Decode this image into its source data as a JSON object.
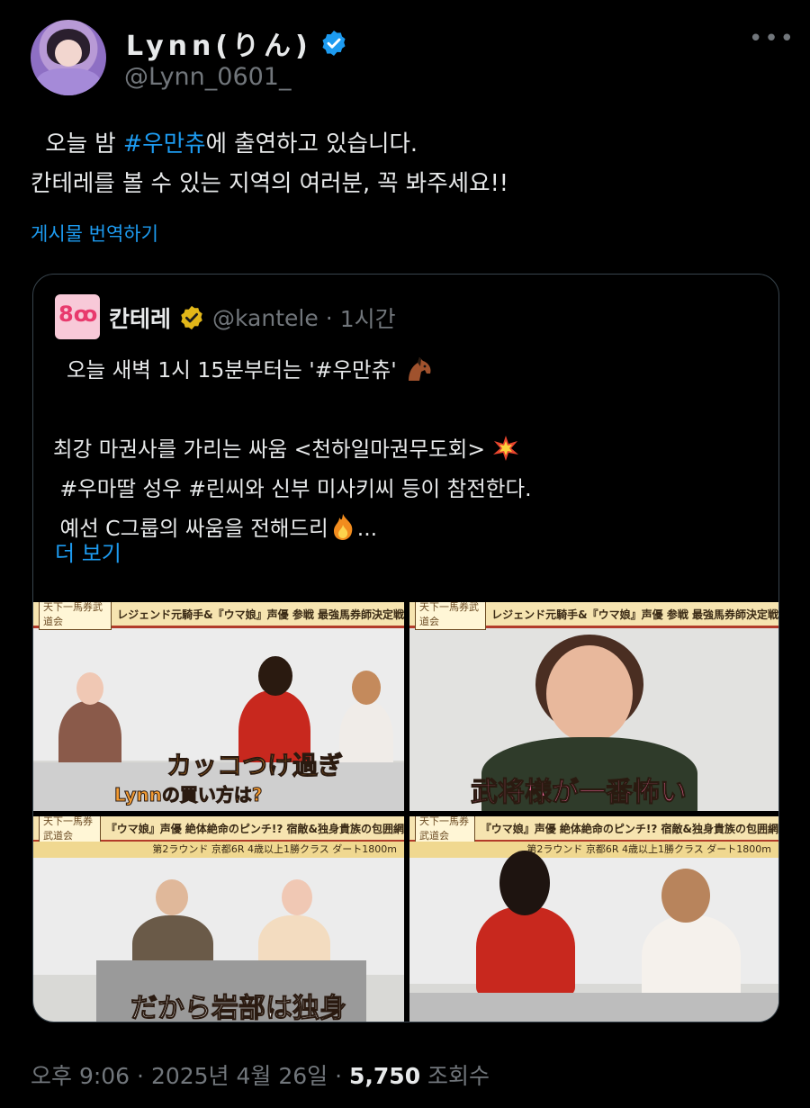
{
  "author": {
    "display_name": "Lynn(りん)",
    "handle": "@Lynn_0601_",
    "verified_color": "#1d9bf0"
  },
  "icons": [
    "verified-icon",
    "more-icon",
    "gold-verified-icon",
    "horse-emoji",
    "collision-emoji",
    "fire-emoji"
  ],
  "tweet": {
    "line1_pre": "  오늘 밤 ",
    "line1_tag": "#우만츄",
    "line1_post": "에 출연하고 있습니다.",
    "line2": "칸테레를 볼 수 있는 지역의 여러분, 꼭 봐주세요!!",
    "translate_label": "게시물 번역하기"
  },
  "quote": {
    "avatar_text": "8ꚙ",
    "name": "칸테레",
    "handle": "@kantele",
    "separator": " · ",
    "time": "1시간",
    "line1": "  오늘 새벽 1시 15분부터는 '#우만츄'",
    "line3": "최강 마권사를 가리는 싸움 <천하일마권무도회>",
    "line4": " #우마딸 성우 #린씨와 신부 미사키씨 등이 참전한다.",
    "line5": " 예선 C그룹의 싸움을 전해드리",
    "line5_end": "...",
    "more_label": "더 보기",
    "gold_badge_color": "#e2b719"
  },
  "media": [
    {
      "tag": "天下一馬券武道会",
      "banner": "レジェンド元騎手&『ウマ娘』声優 参戦 最強馬券師決定戦",
      "sub": "",
      "caption": "カッコつけ過ぎ",
      "caption2": "Lynnの買い方は?"
    },
    {
      "tag": "天下一馬券武道会",
      "banner": "レジェンド元騎手&『ウマ娘』声優 参戦 最強馬券師決定戦",
      "sub": "",
      "caption": "武将様が一番怖い",
      "caption2": ""
    },
    {
      "tag": "天下一馬券武道会",
      "banner": "『ウマ娘』声優 絶体絶命のピンチ!? 宿敵&独身貴族の包囲網",
      "sub": "第2ラウンド 京都6R 4歳以上1勝クラス ダート1800m",
      "caption": "だから岩部は独身",
      "caption2": ""
    },
    {
      "tag": "天下一馬券武道会",
      "banner": "『ウマ娘』声優 絶体絶命のピンチ!? 宿敵&独身貴族の包囲網",
      "sub": "第2ラウンド 京都6R 4歳以上1勝クラス ダート1800m",
      "caption": "",
      "caption2": ""
    }
  ],
  "footer": {
    "time": "오후 9:06",
    "sep": " · ",
    "date": "2025년 4월 26일",
    "sep2": " · ",
    "views": "5,750",
    "views_label": " 조회수"
  }
}
